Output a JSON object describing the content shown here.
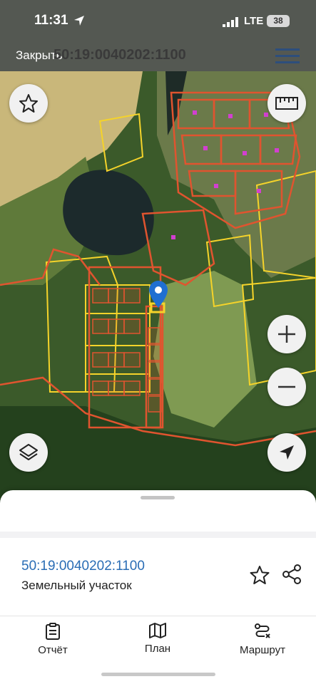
{
  "status_bar": {
    "time": "11:31",
    "network": "LTE",
    "battery": "38"
  },
  "header": {
    "close_label": "Закрыть",
    "title": "50:19:0040202:1100"
  },
  "icons": {
    "favorite": "star-icon",
    "ruler": "ruler-icon",
    "zoom_in": "plus-icon",
    "zoom_out": "minus-icon",
    "layers": "layers-icon",
    "locate": "navigation-arrow-icon",
    "menu": "hamburger-menu-icon"
  },
  "colors": {
    "parcel_border": "#e0542f",
    "highlight": "#f5d32a",
    "pin": "#1f6fd1",
    "link": "#2a6db5"
  },
  "parcel": {
    "cadastral_number": "50:19:0040202:1100",
    "type": "Земельный участок"
  },
  "actions": [
    {
      "label": "Отчёт",
      "icon": "report-icon"
    },
    {
      "label": "План",
      "icon": "map-icon"
    },
    {
      "label": "Маршрут",
      "icon": "route-icon"
    }
  ]
}
